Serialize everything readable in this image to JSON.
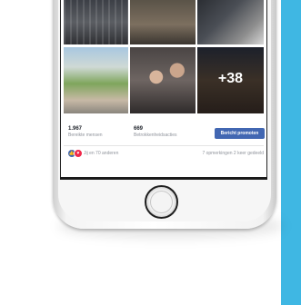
{
  "post": {
    "photos": [
      {
        "name": "photo-1"
      },
      {
        "name": "photo-2"
      },
      {
        "name": "photo-3"
      },
      {
        "name": "photo-4"
      },
      {
        "name": "photo-5"
      },
      {
        "name": "photo-6"
      }
    ],
    "more_photos_label": "+38"
  },
  "insights": {
    "reach_value": "1.967",
    "reach_label": "Bereikte mensen",
    "engagement_value": "669",
    "engagement_label": "Betrokkenheidsacties",
    "promote_button": "Bericht promoten"
  },
  "footer": {
    "reactions_icons": [
      "like-icon",
      "love-icon"
    ],
    "reactions_text": "Jij en 70 anderen",
    "comments_shares": "7 opmerkingen  2 keer gedeeld"
  },
  "colors": {
    "accent": "#4267b2",
    "side_stripe": "#3fb7e3",
    "love": "#f0284a"
  }
}
